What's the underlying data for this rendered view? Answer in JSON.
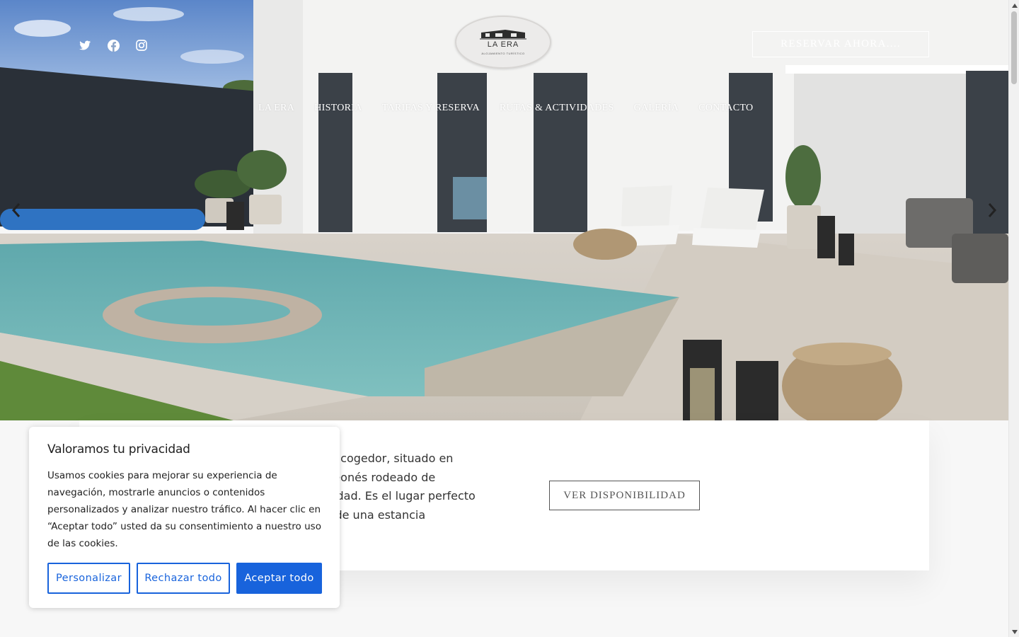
{
  "header": {
    "social": [
      {
        "icon": "twitter-icon"
      },
      {
        "icon": "facebook-icon"
      },
      {
        "icon": "instagram-icon"
      }
    ],
    "logo": {
      "name": "LA ERA",
      "subtitle": "ALOJAMIENTO TURÍSTICO"
    },
    "reserve_label": "RESERVAR AHORA....",
    "nav": [
      {
        "label": "LA ERA"
      },
      {
        "label": "HISTORIA"
      },
      {
        "label": "TARIFAS Y RESERVA"
      },
      {
        "label": "RUTAS & ACTIVIDADES"
      },
      {
        "label": "GALERÍA"
      },
      {
        "label": "CONTACTO"
      }
    ]
  },
  "slider": {
    "prev_icon": "chevron-left-icon",
    "next_icon": "chevron-right-icon"
  },
  "content": {
    "intro_visible": "al acogedor, situado en\no leonés rodeado de\nuilidad. Es el lugar perfecto\nar de una estancia",
    "availability_label": "VER DISPONIBILIDAD"
  },
  "cookie": {
    "title": "Valoramos tu privacidad",
    "text": "Usamos cookies para mejorar su experiencia de navegación, mostrarle anuncios o contenidos personalizados y analizar nuestro tráfico. Al hacer clic en “Aceptar todo” usted da su consentimiento a nuestro uso de las cookies.",
    "customize_label": "Personalizar",
    "reject_label": "Rechazar todo",
    "accept_label": "Aceptar todo"
  },
  "colors": {
    "accent": "#1863dc",
    "text": "#212121"
  }
}
